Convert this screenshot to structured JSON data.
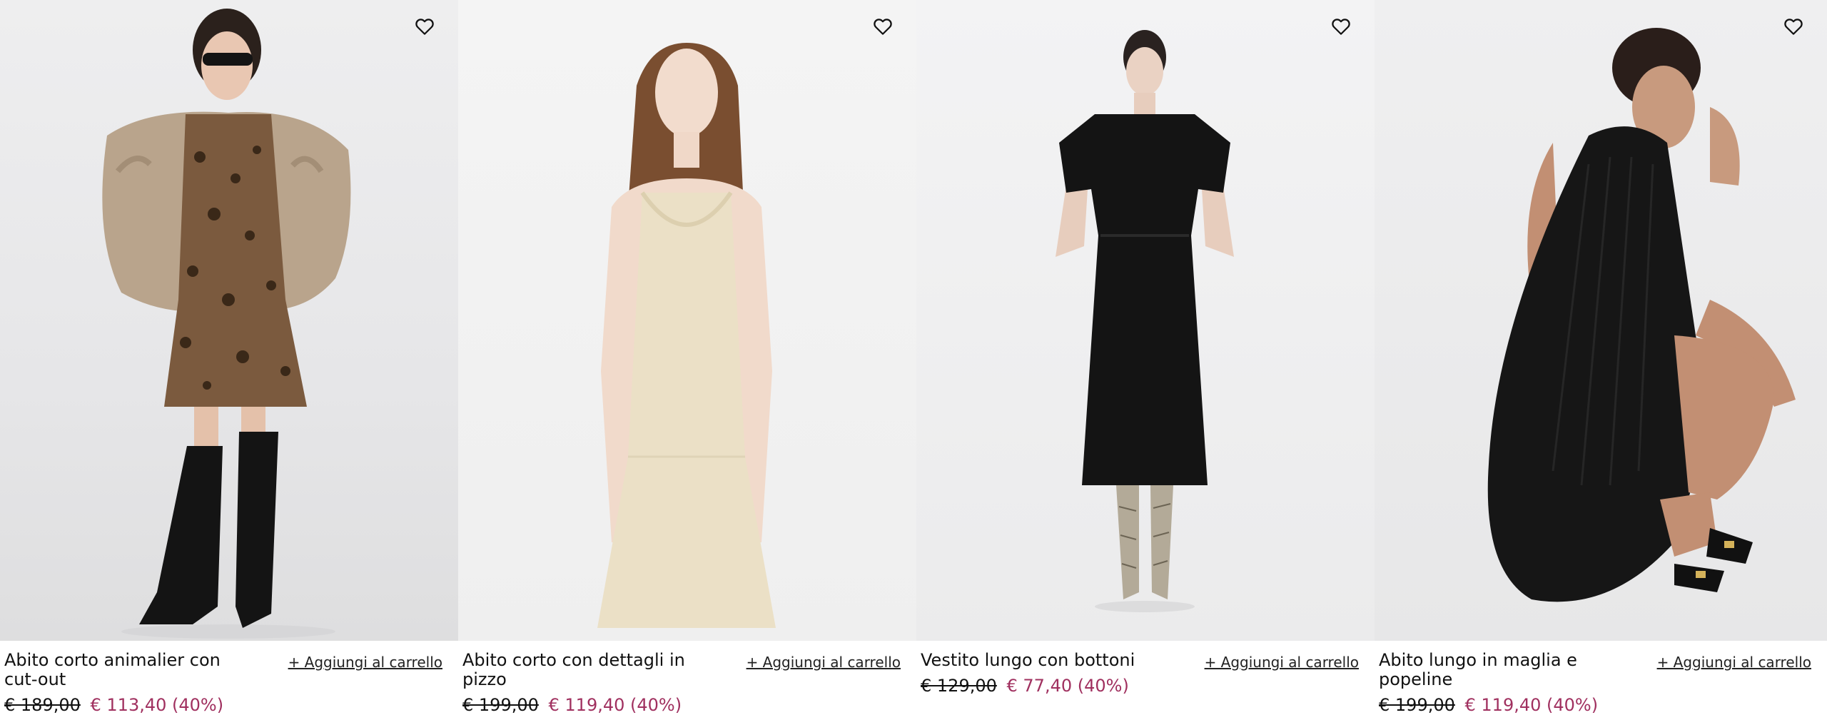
{
  "products": [
    {
      "name": "Abito corto animalier con cut-out",
      "old_price": "€ 189,00",
      "new_price": "€ 113,40 (40%)",
      "add_to_cart": "+ Aggiungi al carrello",
      "wishlist_icon": "heart-outline-icon"
    },
    {
      "name": "Abito corto con dettagli in pizzo",
      "old_price": "€ 199,00",
      "new_price": "€ 119,40 (40%)",
      "add_to_cart": "+ Aggiungi al carrello",
      "wishlist_icon": "heart-outline-icon"
    },
    {
      "name": "Vestito lungo con bottoni",
      "old_price": "€ 129,00",
      "new_price": "€ 77,40 (40%)",
      "add_to_cart": "+ Aggiungi al carrello",
      "wishlist_icon": "heart-outline-icon"
    },
    {
      "name": "Abito lungo in maglia e popeline",
      "old_price": "€ 199,00",
      "new_price": "€ 119,40 (40%)",
      "add_to_cart": "+ Aggiungi al carrello",
      "wishlist_icon": "heart-outline-icon"
    }
  ],
  "colors": {
    "sale_price": "#a0305f",
    "text": "#111111"
  }
}
